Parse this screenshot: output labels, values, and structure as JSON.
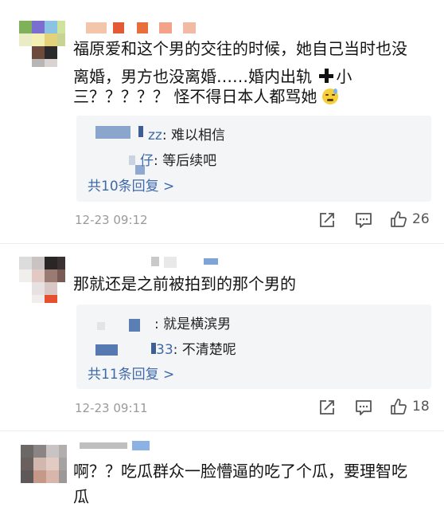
{
  "comments": [
    {
      "text_lines": [
        "福原爱和这个男的交往的时候，她自己当时也没",
        "离婚，男方也没离婚……婚内出轨",
        "小",
        "三？？？？？ 怪不得日本人都骂她"
      ],
      "replies": [
        {
          "user_tail": "zz",
          "text": "难以相信"
        },
        {
          "user_tail": "仔",
          "text": "等后续吧"
        }
      ],
      "more_replies": "共10条回复 >",
      "time": "12-23 09:12",
      "likes": "26"
    },
    {
      "text_lines": [
        "那就还是之前被拍到的那个男的"
      ],
      "replies": [
        {
          "user_tail": "",
          "text": "就是横滨男"
        },
        {
          "user_tail": "33",
          "text": "不清楚呢"
        }
      ],
      "more_replies": "共11条回复 >",
      "time": "12-23 09:11",
      "likes": "18"
    },
    {
      "text_lines": [
        "啊？？吃瓜群众一脸懵逼的吃了个瓜，要理智吃",
        "瓜"
      ]
    }
  ],
  "icons": {
    "forward": "share-square-icon",
    "reply": "comment-icon",
    "like": "thumbs-up-icon",
    "emoji": "cold-sweat-emoji-icon",
    "plus": "plus-icon"
  },
  "colors": {
    "link": "#3f6aa8",
    "reply_bg": "#f4f5f7",
    "meta": "#9a9a9a"
  }
}
